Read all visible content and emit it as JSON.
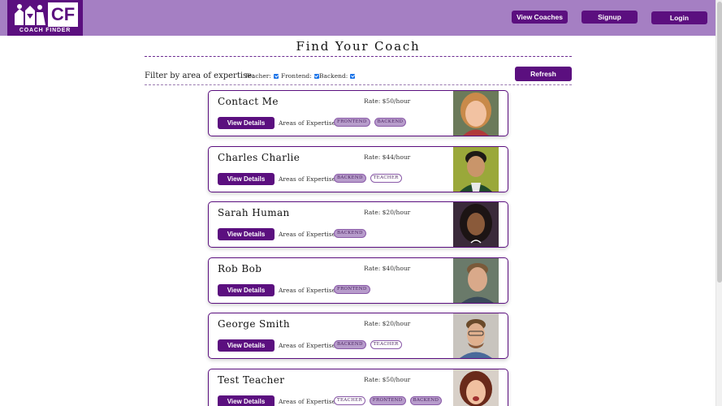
{
  "header": {
    "logo_text": "COACH FINDER",
    "logo_abbr": "CF",
    "nav": [
      "View Coaches",
      "Signup",
      "Login"
    ]
  },
  "page": {
    "title": "Find Your Coach",
    "filter_label": "Filter by area of expertise:",
    "filters": [
      {
        "label": "Teacher:",
        "checked": true
      },
      {
        "label": "Frontend:",
        "checked": true
      },
      {
        "label": "Backend:",
        "checked": true
      }
    ],
    "refresh_label": "Refresh"
  },
  "coaches": [
    {
      "name": "Contact Me",
      "rate": "Rate: $50/hour",
      "details_label": "View Details",
      "expertise_label": "Areas of Expertise:",
      "areas": [
        "frontend",
        "backend"
      ]
    },
    {
      "name": "Charles Charlie",
      "rate": "Rate: $44/hour",
      "details_label": "View Details",
      "expertise_label": "Areas of Expertise:",
      "areas": [
        "backend",
        "teacher"
      ]
    },
    {
      "name": "Sarah Human",
      "rate": "Rate: $20/hour",
      "details_label": "View Details",
      "expertise_label": "Areas of Expertise:",
      "areas": [
        "backend"
      ]
    },
    {
      "name": "Rob Bob",
      "rate": "Rate: $40/hour",
      "details_label": "View Details",
      "expertise_label": "Areas of Expertise:",
      "areas": [
        "frontend"
      ]
    },
    {
      "name": "George Smith",
      "rate": "Rate: $20/hour",
      "details_label": "View Details",
      "expertise_label": "Areas of Expertise:",
      "areas": [
        "backend",
        "teacher"
      ]
    },
    {
      "name": "Test Teacher",
      "rate": "Rate: $50/hour",
      "details_label": "View Details",
      "expertise_label": "Areas of Expertise:",
      "areas": [
        "teacher",
        "frontend",
        "backend"
      ]
    }
  ],
  "colors": {
    "brand": "#5b0f7f",
    "header_bg": "#a57fc3",
    "badge_filled": "#b79ccb"
  }
}
